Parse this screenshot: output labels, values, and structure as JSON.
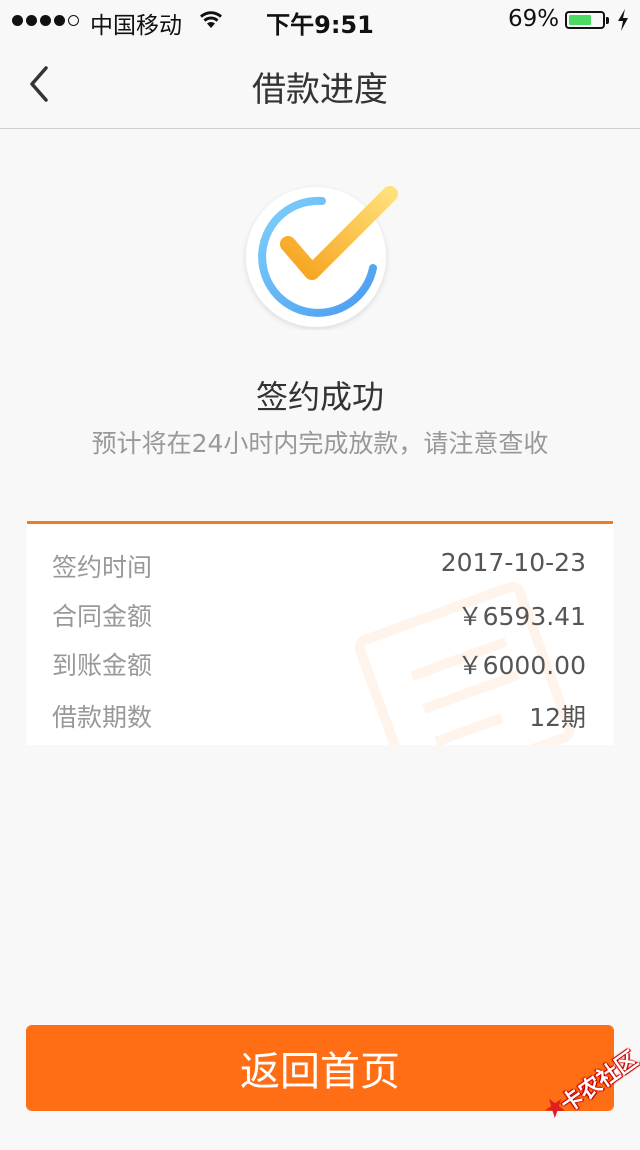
{
  "status_bar": {
    "carrier": "中国移动",
    "time": "下午9:51",
    "battery_percent": "69%",
    "battery_level": 0.69,
    "signal_bars_filled": 4,
    "signal_bars_total": 5
  },
  "nav": {
    "title": "借款进度",
    "back_icon": "chevron-left-icon"
  },
  "result": {
    "icon": "check-circle-icon",
    "title": "签约成功",
    "subtitle": "预计将在24小时内完成放款，请注意查收"
  },
  "details": [
    {
      "label": "签约时间",
      "value": "2017-10-23"
    },
    {
      "label": "合同金额",
      "value": "￥6593.41"
    },
    {
      "label": "到账金额",
      "value": "￥6000.00"
    },
    {
      "label": "借款期数",
      "value": "12期"
    }
  ],
  "actions": {
    "home_label": "返回首页"
  },
  "watermark_badge": {
    "text": "卡农社区"
  },
  "colors": {
    "accent": "#ff6d14",
    "card_border": "#f47a20",
    "ring_blue": "#5fb4f6",
    "check_yellow": "#f9b233"
  }
}
